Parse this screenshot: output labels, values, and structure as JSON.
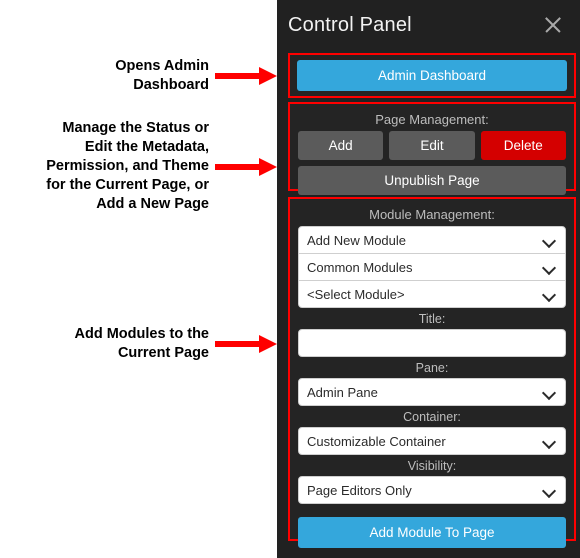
{
  "annotations": [
    {
      "id": "opens-admin-dashboard",
      "text": "Opens Admin\nDashboard",
      "arrow": "right-arrow-icon"
    },
    {
      "id": "manage-page",
      "text": "Manage the Status or\nEdit the Metadata,\nPermission, and Theme\nfor the Current Page, or\nAdd a New Page",
      "arrow": "right-arrow-icon"
    },
    {
      "id": "add-modules",
      "text": "Add Modules to the\nCurrent Page",
      "arrow": "right-arrow-icon"
    }
  ],
  "panel": {
    "title": "Control Panel",
    "close_icon": "close-icon",
    "admin_dashboard": {
      "label": "Admin Dashboard"
    },
    "page_management": {
      "section_label": "Page Management:",
      "buttons": [
        {
          "label": "Add",
          "style": "gray"
        },
        {
          "label": "Edit",
          "style": "gray"
        },
        {
          "label": "Delete",
          "style": "red"
        }
      ],
      "unpublish": {
        "label": "Unpublish Page"
      }
    },
    "module_management": {
      "section_label": "Module Management:",
      "selects": [
        {
          "name": "module-source-select",
          "value": "Add New Module",
          "icon": "chevron-down-icon"
        },
        {
          "name": "module-category-select",
          "value": "Common Modules",
          "icon": "chevron-down-icon"
        },
        {
          "name": "module-select",
          "value": "<Select Module>",
          "icon": "chevron-down-icon"
        }
      ],
      "title_field": {
        "label": "Title:",
        "value": "",
        "placeholder": ""
      },
      "pane_field": {
        "label": "Pane:",
        "value": "Admin Pane",
        "icon": "chevron-down-icon"
      },
      "container_field": {
        "label": "Container:",
        "value": "Customizable Container",
        "icon": "chevron-down-icon"
      },
      "visibility_field": {
        "label": "Visibility:",
        "value": "Page Editors Only",
        "icon": "chevron-down-icon"
      },
      "add_module_button": {
        "label": "Add Module To Page"
      }
    }
  },
  "colors": {
    "accent_blue": "#34a7dc",
    "danger_red": "#d40000",
    "highlight_red": "#ff0000",
    "panel_bg": "#212121",
    "button_gray": "#5b5b5b"
  }
}
